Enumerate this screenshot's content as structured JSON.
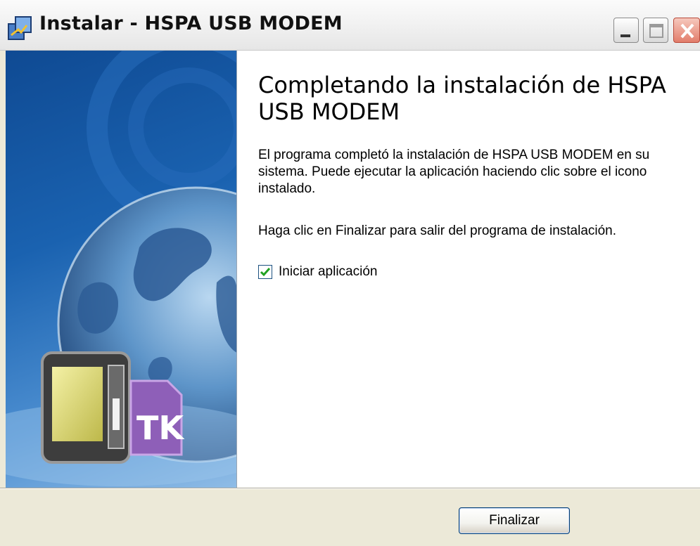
{
  "window": {
    "title": "Instalar - HSPA USB MODEM",
    "app_icon": "installer-icon",
    "controls": {
      "minimize_icon": "minimize-icon",
      "maximize_icon": "maximize-icon",
      "close_icon": "close-icon"
    }
  },
  "banner": {
    "image": "globe-modem-banner",
    "logo_text": "TK"
  },
  "main": {
    "heading": "Completando la instalación de HSPA USB MODEM",
    "paragraph1": "El programa completó la instalación de HSPA USB MODEM en su sistema. Puede ejecutar la aplicación haciendo clic sobre el icono instalado.",
    "paragraph2": "Haga clic en Finalizar para salir del programa de instalación.",
    "launch_checkbox": {
      "label": "Iniciar aplicación",
      "checked": true
    }
  },
  "footer": {
    "finish_label": "Finalizar"
  },
  "colors": {
    "dialog_bg": "#ece9d8",
    "banner_blue": "#1a62b0",
    "checkbox_check": "#21a121",
    "close_button": "#e27d6b"
  }
}
